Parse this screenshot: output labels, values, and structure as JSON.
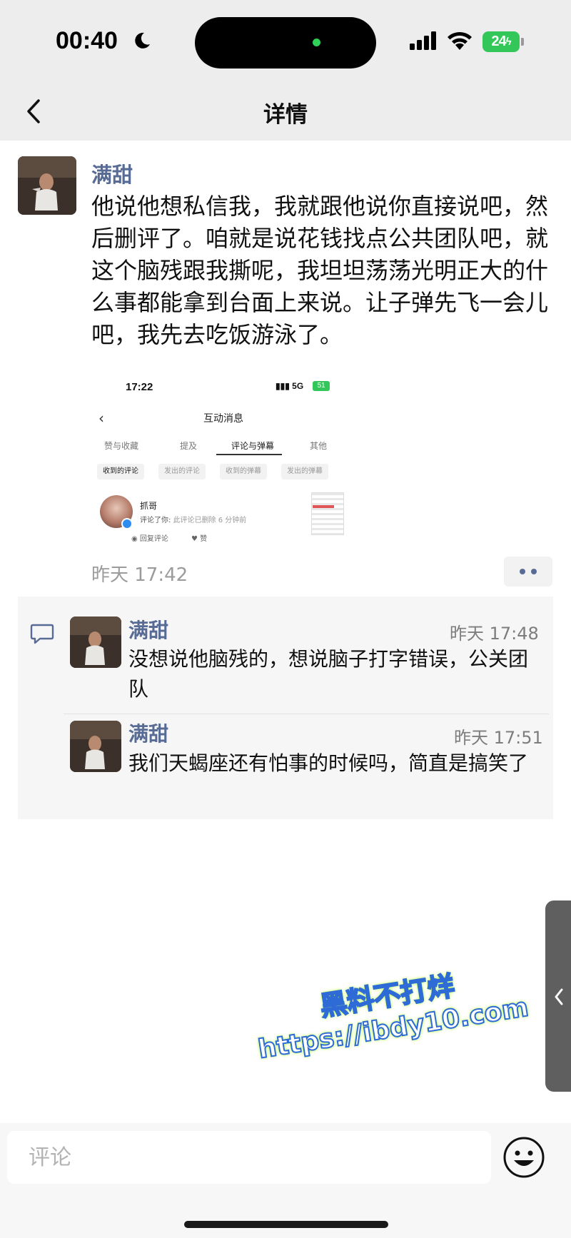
{
  "status_bar": {
    "time": "00:40",
    "battery": "24",
    "icons": [
      "moon-icon",
      "signal-icon",
      "wifi-icon",
      "battery-icon"
    ]
  },
  "nav": {
    "title": "详情",
    "back_icon": "chevron-left-icon"
  },
  "post": {
    "author": "满甜",
    "text": "他说他想私信我，我就跟他说你直接说吧，然后删评了。咱就是说花钱找点公共团队吧，就这个脑残跟我撕呢，我坦坦荡荡光明正大的什么事都能拿到台面上来说。让子弹先飞一会儿吧，我先去吃饭游泳了。",
    "time": "昨天 17:42",
    "more_icon": "more-dots-icon",
    "attached_screenshot": {
      "time": "17:22",
      "network": "5G",
      "battery": "51",
      "title": "互动消息",
      "tabs": [
        "赞与收藏",
        "提及",
        "评论与弹幕",
        "其他"
      ],
      "active_tab": "评论与弹幕",
      "chips": [
        "收到的评论",
        "发出的评论",
        "收到的弹幕",
        "发出的弹幕"
      ],
      "active_chip": "收到的评论",
      "item": {
        "name": "抓哥",
        "line_prefix": "评论了你:",
        "line_quote": "此评论已删除",
        "line_time": "6 分钟前",
        "reply": "回复评论",
        "like": "赞"
      }
    }
  },
  "comments": [
    {
      "author": "满甜",
      "time": "昨天 17:48",
      "text": "没想说他脑残的，想说脑子打字错误，公关团队"
    },
    {
      "author": "满甜",
      "time": "昨天 17:51",
      "text": "我们天蝎座还有怕事的时候吗，简直是搞笑了"
    }
  ],
  "watermark": {
    "line1": "黑料不打烊",
    "line2": "https://ibdy10.com"
  },
  "bottom": {
    "placeholder": "评论",
    "emoji_icon": "emoji-icon"
  },
  "colors": {
    "author": "#576b95",
    "background_bar": "#ededed",
    "battery": "#33c759"
  }
}
